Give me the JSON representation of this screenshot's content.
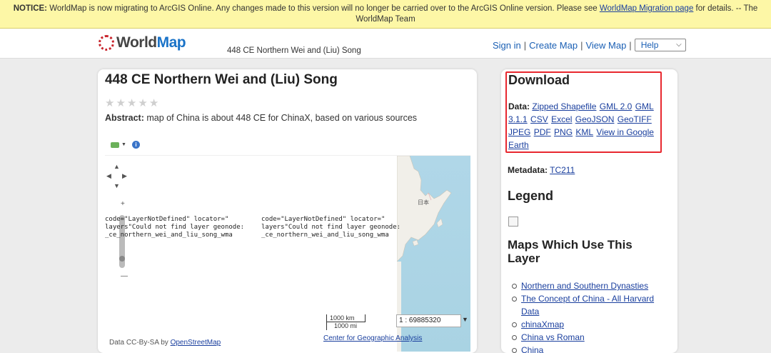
{
  "notice": {
    "label": "NOTICE:",
    "text": "WorldMap is now migrating to ArcGIS Online. Any changes made to this version will no longer be carried over to the ArcGIS Online version. Please see",
    "link": "WorldMap Migration page",
    "after": "for details. -- The WorldMap Team"
  },
  "header": {
    "logo_word": "World",
    "logo_map": "Map",
    "layer_title": "448 CE Northern Wei and (Liu) Song",
    "nav": {
      "sign_in": "Sign in",
      "create_map": "Create Map",
      "view_map": "View Map",
      "help": "Help"
    }
  },
  "main": {
    "title": "448 CE Northern Wei and (Liu) Song",
    "rating": {
      "value": 0,
      "max": 5
    },
    "abstract_label": "Abstract:",
    "abstract_text": "map of China is about 448 CE for ChinaX, based on various sources",
    "map": {
      "error_1": "code=\"LayerNotDefined\" locator=\"\nlayers\"Could not find layer geonode:\n_ce_northern_wei_and_liu_song_wma",
      "error_2": "code=\"LayerNotDefined\" locator=\"\nlayers\"Could not find layer geonode:\n_ce_northern_wei_and_liu_song_wma",
      "map_label": "日本",
      "scale_km": "1000 km",
      "scale_mi": "1000 mi",
      "scale_ratio": "1 : 69885320",
      "credit_link": "Center for Geographic Analysis",
      "attribution_prefix": "Data CC-By-SA by",
      "attribution_link": "OpenStreetMap"
    }
  },
  "sidebar": {
    "download": {
      "title": "Download",
      "data_label": "Data:",
      "links": [
        "Zipped Shapefile",
        "GML 2.0",
        "GML 3.1.1",
        "CSV",
        "Excel",
        "GeoJSON",
        "GeoTIFF",
        "JPEG",
        "PDF",
        "PNG",
        "KML",
        "View in Google Earth"
      ]
    },
    "metadata": {
      "label": "Metadata:",
      "link": "TC211"
    },
    "legend_title": "Legend",
    "maps_title": "Maps Which Use This Layer",
    "maps": [
      "Northern and Southern Dynasties",
      "The Concept of China - All Harvard Data",
      "chinaXmap",
      "China vs Roman",
      "China"
    ]
  }
}
